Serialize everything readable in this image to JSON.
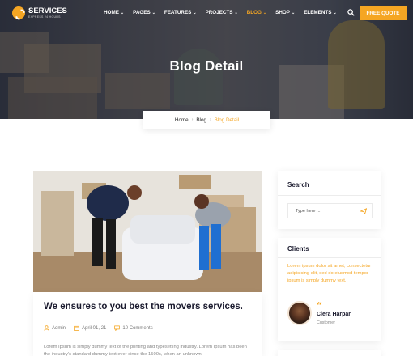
{
  "brand": {
    "name": "SERVICES",
    "tagline": "EXPRESS 24 HOURS"
  },
  "nav": {
    "items": [
      {
        "label": "HOME",
        "active": false
      },
      {
        "label": "PAGES",
        "active": false
      },
      {
        "label": "FEATURES",
        "active": false
      },
      {
        "label": "PROJECTS",
        "active": false
      },
      {
        "label": "BLOG",
        "active": true
      },
      {
        "label": "SHOP",
        "active": false
      },
      {
        "label": "ELEMENTS",
        "active": false
      }
    ],
    "quote_button": "FREE QUOTE",
    "search_icon": "search-icon"
  },
  "hero": {
    "title": "Blog Detail"
  },
  "breadcrumb": {
    "home": "Home",
    "blog": "Blog",
    "current": "Blog Detail"
  },
  "post": {
    "title": "We ensures to you best the movers services.",
    "author": "Admin",
    "date": "April 01, 21",
    "comments": "10 Comments",
    "excerpt": "Lorem Ipsum is simply dummy text of the printing and typesetting industry. Lorem Ipsum has been the industry's standard dummy text ever since the 1500s, when an unknown"
  },
  "sidebar": {
    "search": {
      "title": "Search",
      "placeholder": "Type here ..."
    },
    "clients": {
      "title": "Clients",
      "text": "Lorem ipsum dolor sit amet; consectetur adipisicing elit, sed do eiusmod tempor ipsum is simply dummy text.",
      "name": "Clera Harpar",
      "role": "Customer"
    }
  },
  "colors": {
    "accent": "#f5a623",
    "heading": "#1a1a2e"
  }
}
